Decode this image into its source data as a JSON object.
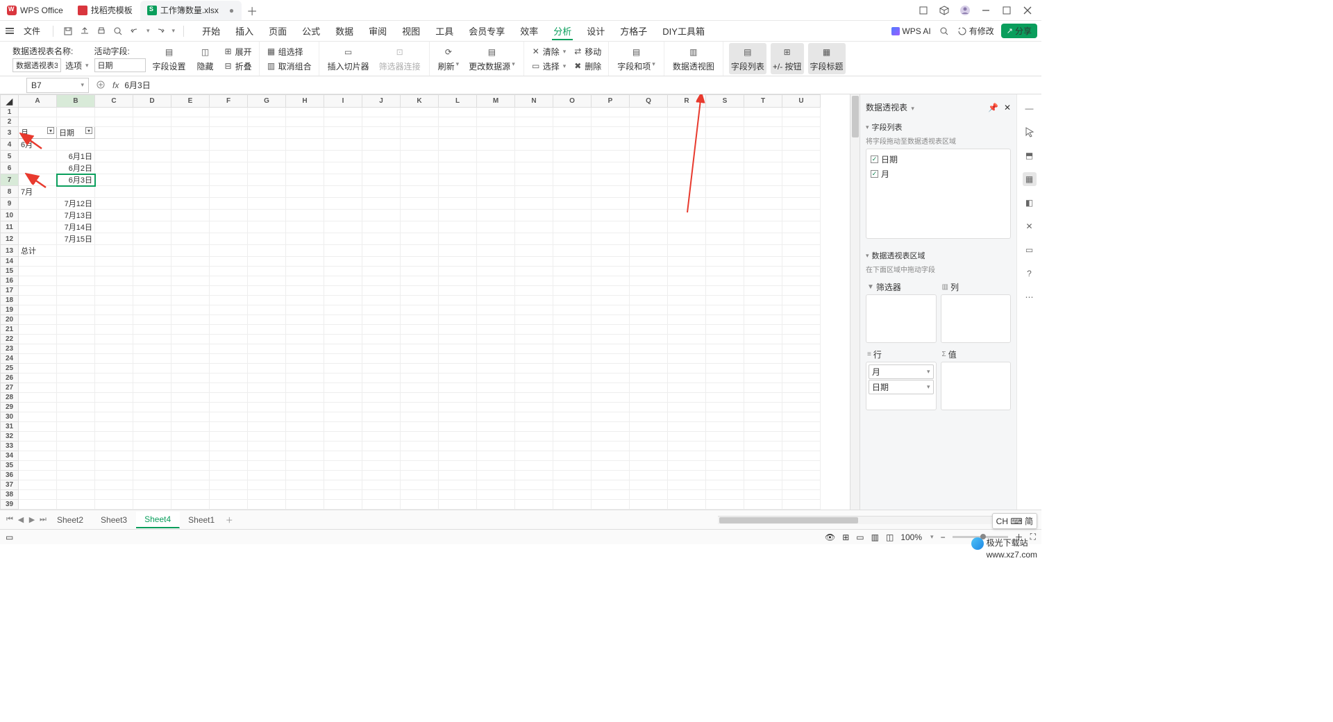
{
  "titlebar": {
    "tabs": [
      {
        "label": "WPS Office",
        "icon": "wps"
      },
      {
        "label": "找稻壳模板",
        "icon": "doc"
      },
      {
        "label": "工作簿数量.xlsx",
        "icon": "sheet",
        "modified": "●"
      }
    ]
  },
  "menubar": {
    "file": "文件",
    "tabs": [
      "开始",
      "插入",
      "页面",
      "公式",
      "数据",
      "审阅",
      "视图",
      "工具",
      "会员专享",
      "效率",
      "分析",
      "设计",
      "方格子",
      "DIY工具箱"
    ],
    "active": "分析",
    "wpsai": "WPS AI",
    "pending": "有修改",
    "share": "分享"
  },
  "ribbon": {
    "name_label": "数据透视表名称:",
    "table_name": "数据透视表3",
    "options": "选项",
    "active_field_label": "活动字段:",
    "active_field": "日期",
    "field_settings": "字段设置",
    "hide": "隐藏",
    "expand": "展开",
    "collapse": "折叠",
    "group_sel": "组选择",
    "ungroup": "取消组合",
    "slicer": "插入切片器",
    "conn": "筛选器连接",
    "refresh": "刷新",
    "change_src": "更改数据源",
    "clear": "清除",
    "select": "选择",
    "move": "移动",
    "delete": "删除",
    "fields_items": "字段和项",
    "pivot_chart": "数据透视图",
    "field_list": "字段列表",
    "pm_btn": "+/- 按钮",
    "field_hdr": "字段标题"
  },
  "formula_bar": {
    "name_box": "B7",
    "fx": "fx",
    "value": "6月3日"
  },
  "columns": [
    "A",
    "B",
    "C",
    "D",
    "E",
    "F",
    "G",
    "H",
    "I",
    "J",
    "K",
    "L",
    "M",
    "N",
    "O",
    "P",
    "Q",
    "R",
    "S",
    "T",
    "U"
  ],
  "pivot": {
    "hdr_month": "月",
    "hdr_date": "日期",
    "rows": [
      {
        "a": "6月",
        "b": ""
      },
      {
        "a": "",
        "b": "6月1日"
      },
      {
        "a": "",
        "b": "6月2日"
      },
      {
        "a": "",
        "b": "6月3日"
      },
      {
        "a": "7月",
        "b": ""
      },
      {
        "a": "",
        "b": "7月12日"
      },
      {
        "a": "",
        "b": "7月13日"
      },
      {
        "a": "",
        "b": "7月14日"
      },
      {
        "a": "",
        "b": "7月15日"
      },
      {
        "a": "总计",
        "b": ""
      }
    ]
  },
  "panel": {
    "title": "数据透视表",
    "fields_hdr": "字段列表",
    "fields_hint": "将字段拖动至数据透视表区域",
    "fields": [
      {
        "name": "日期",
        "checked": true
      },
      {
        "name": "月",
        "checked": true
      }
    ],
    "areas_hdr": "数据透视表区域",
    "areas_hint": "在下面区域中拖动字段",
    "filter_label": "筛选器",
    "column_label": "列",
    "row_label": "行",
    "value_label": "值",
    "row_items": [
      "月",
      "日期"
    ]
  },
  "sheets": {
    "list": [
      "Sheet2",
      "Sheet3",
      "Sheet4",
      "Sheet1"
    ],
    "active": "Sheet4"
  },
  "status": {
    "zoom": "100%",
    "lang": "CH ⌨ 简"
  },
  "watermark": {
    "name": "极光下载站",
    "url": "www.xz7.com"
  }
}
